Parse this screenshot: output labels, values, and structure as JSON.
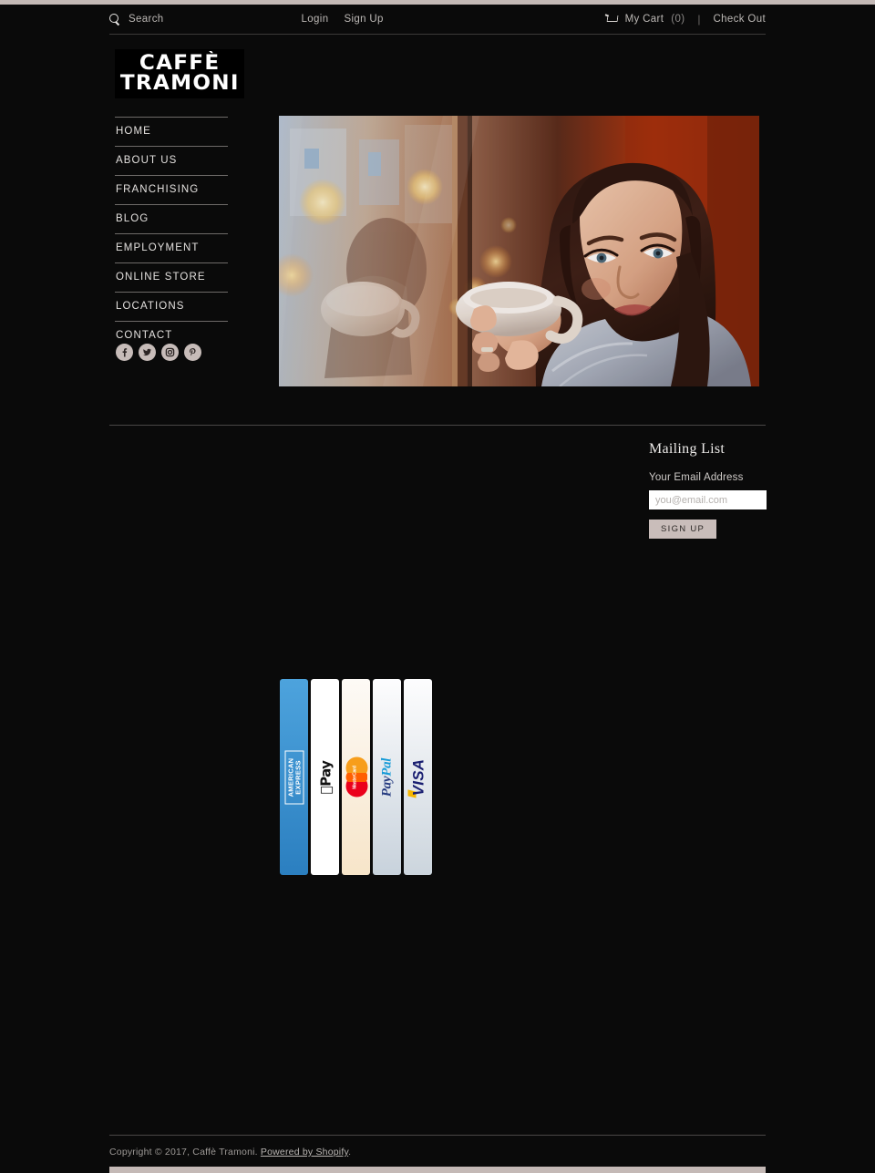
{
  "theme": {
    "background": "#0a0a0a",
    "accent_bar": "#c4b9b6",
    "button_bg": "#c9bdba",
    "text": "#e4e1df",
    "muted_text": "#bcb8b5"
  },
  "utility_bar": {
    "search_icon": "search-icon",
    "search_label": "Search",
    "login_label": "Login",
    "signup_label": "Sign Up",
    "cart_icon": "shopping-cart-icon",
    "cart_label": "My Cart",
    "cart_count": "(0)",
    "separator": "|",
    "checkout_label": "Check Out"
  },
  "logo": {
    "line1": "CAFFÈ",
    "line2": "TRAMONI"
  },
  "sidebar": {
    "items": [
      {
        "label": "HOME"
      },
      {
        "label": "ABOUT US"
      },
      {
        "label": "FRANCHISING"
      },
      {
        "label": "BLOG"
      },
      {
        "label": "EMPLOYMENT"
      },
      {
        "label": "ONLINE STORE"
      },
      {
        "label": "LOCATIONS"
      },
      {
        "label": "CONTACT"
      }
    ],
    "social": [
      {
        "name": "facebook-icon",
        "glyph": "f"
      },
      {
        "name": "twitter-icon",
        "glyph": "t"
      },
      {
        "name": "instagram-icon",
        "glyph": "i"
      },
      {
        "name": "pinterest-icon",
        "glyph": "p"
      }
    ]
  },
  "hero": {
    "alt": "woman drinking coffee by a cafe window at sunset"
  },
  "mailing_list": {
    "title": "Mailing List",
    "field_label": "Your Email Address",
    "input_value": "",
    "input_placeholder": "you@email.com",
    "button_label": "SIGN UP"
  },
  "payments": [
    {
      "name": "american-express-icon",
      "label": "AMERICAN EXPRESS"
    },
    {
      "name": "apple-pay-icon",
      "label": "Apple Pay"
    },
    {
      "name": "mastercard-icon",
      "label": "MasterCard"
    },
    {
      "name": "paypal-icon",
      "label": "PayPal"
    },
    {
      "name": "visa-icon",
      "label": "VISA"
    }
  ],
  "footer": {
    "copyright": "Copyright © 2017, Caffè Tramoni.",
    "powered_by": "Powered by Shopify",
    "period": "."
  }
}
